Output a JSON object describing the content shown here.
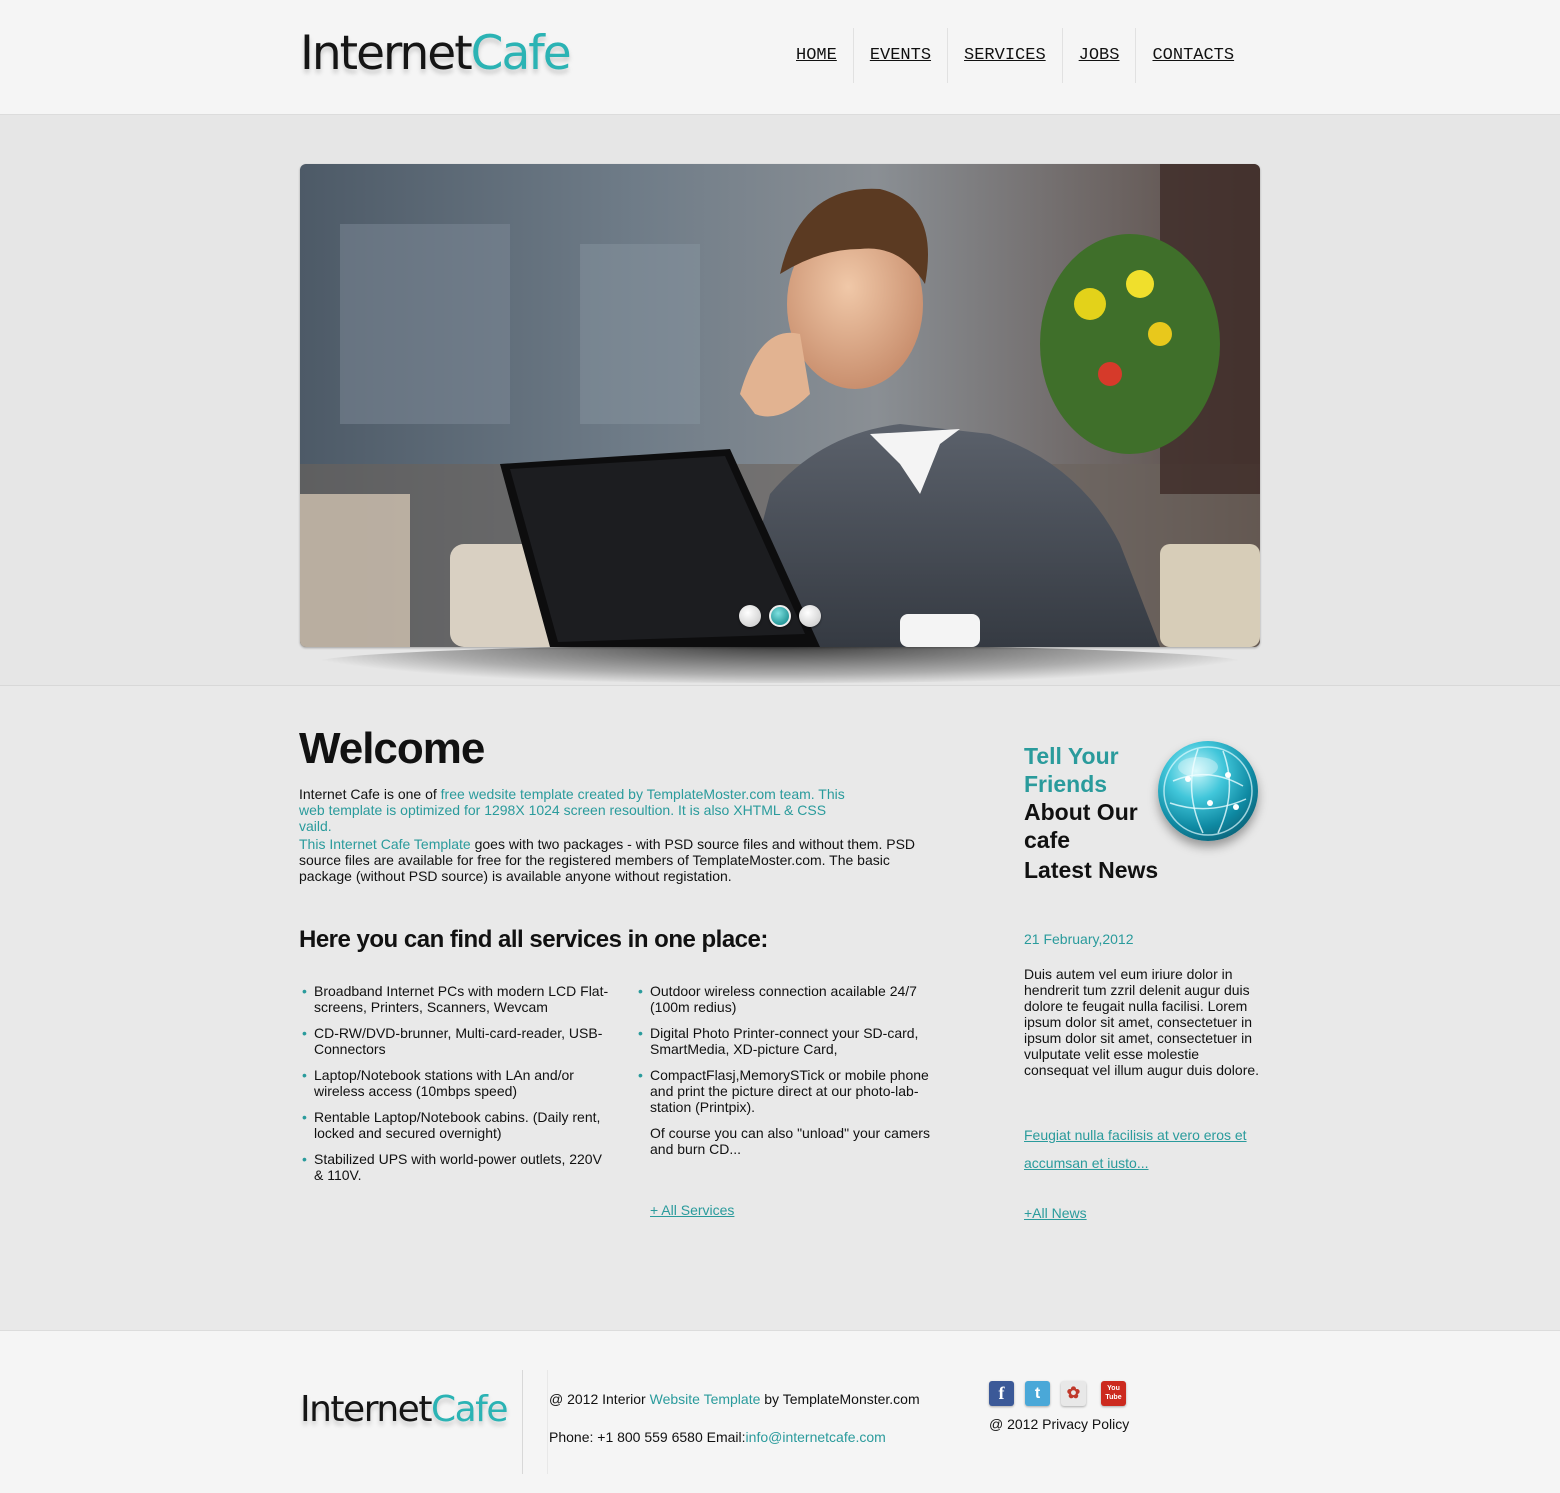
{
  "header": {
    "logo": {
      "part1": "Internet",
      "part2": "Cafe"
    },
    "nav": [
      "HOME",
      "EVENTS",
      "SERVICES",
      "JOBS",
      "CONTACTS"
    ]
  },
  "hero": {
    "active_slide": 2,
    "slide_count": 3
  },
  "welcome": {
    "title": "Welcome",
    "p1_plain": "Internet Cafe is one of ",
    "p1_link": "free wedsite template created by TemplateMoster.com team. This web template is optimized for 1298X 1024 screen resoultion. It is also XHTML & CSS vaild.",
    "p2_link": "This Internet Cafe Template",
    "p2_plain": " goes with two packages - with PSD source files and without them. PSD source files are available for free for the registered members of TemplateMoster.com. The basic package (without PSD source) is available anyone without registation."
  },
  "services": {
    "title": "Here you can find all services in one place:",
    "left": [
      "Broadband Internet PCs with modern LCD Flat-screens, Printers, Scanners, Wevcam",
      "CD-RW/DVD-brunner, Multi-card-reader, USB-Connectors",
      "Laptop/Notebook stations with LAn and/or wireless access (10mbps speed)",
      "Rentable Laptop/Notebook cabins. (Daily rent, locked and secured overnight)",
      "Stabilized UPS with world-power outlets, 220V & 110V."
    ],
    "right": [
      "Outdoor wireless connection acailable 24/7 (100m redius)",
      "Digital Photo Printer-connect your SD-card, SmartMedia, XD-picture Card,",
      "CompactFlasj,MemorySTick or mobile phone and print the picture direct at our photo-lab-station (Printpix)."
    ],
    "extra": "Of course you can also \"unload\" your camers and burn CD...",
    "all_link": "+ All Services"
  },
  "sidebar": {
    "tell_line1": "Tell Your",
    "tell_line2": "Friends",
    "about_line1": "About Our",
    "about_line2": "cafe",
    "latest_news": "Latest News",
    "news_date": "21 February,2012",
    "news_body": "Duis autem vel eum iriure dolor in hendrerit tum zzril delenit augur duis dolore te feugait nulla facilisi. Lorem ipsum dolor sit amet, consectetuer in ipsum dolor sit amet, consectetuer in vulputate velit esse molestie consequat vel illum augur duis dolore.",
    "news_link": "Feugiat nulla facilisis at vero eros et accumsan et iusto...",
    "all_news": "+All News"
  },
  "footer": {
    "logo": {
      "part1": "Internet",
      "part2": "Cafe"
    },
    "line1_a": "@ 2012 Interior ",
    "line1_link": "Website Template",
    "line1_b": " by TemplateMonster.com",
    "line2_a": "Phone: +1 800 559 6580 Email:",
    "email": "info@internetcafe.com",
    "privacy": "@ 2012 Privacy Policy",
    "social": [
      {
        "icon": "facebook-icon",
        "glyph": "f",
        "color": "#3b5998"
      },
      {
        "icon": "twitter-icon",
        "glyph": "t",
        "color": "#4aa8d8"
      },
      {
        "icon": "picasa-icon",
        "glyph": "✿",
        "color": "#e8e8e8"
      },
      {
        "icon": "youtube-icon",
        "glyph": "You Tube",
        "color": "#cc2a1f"
      }
    ]
  },
  "colors": {
    "accent": "#2a9b9c",
    "logo_accent": "#2bb3b4",
    "text": "#111111",
    "background": "#e9e9e9"
  }
}
